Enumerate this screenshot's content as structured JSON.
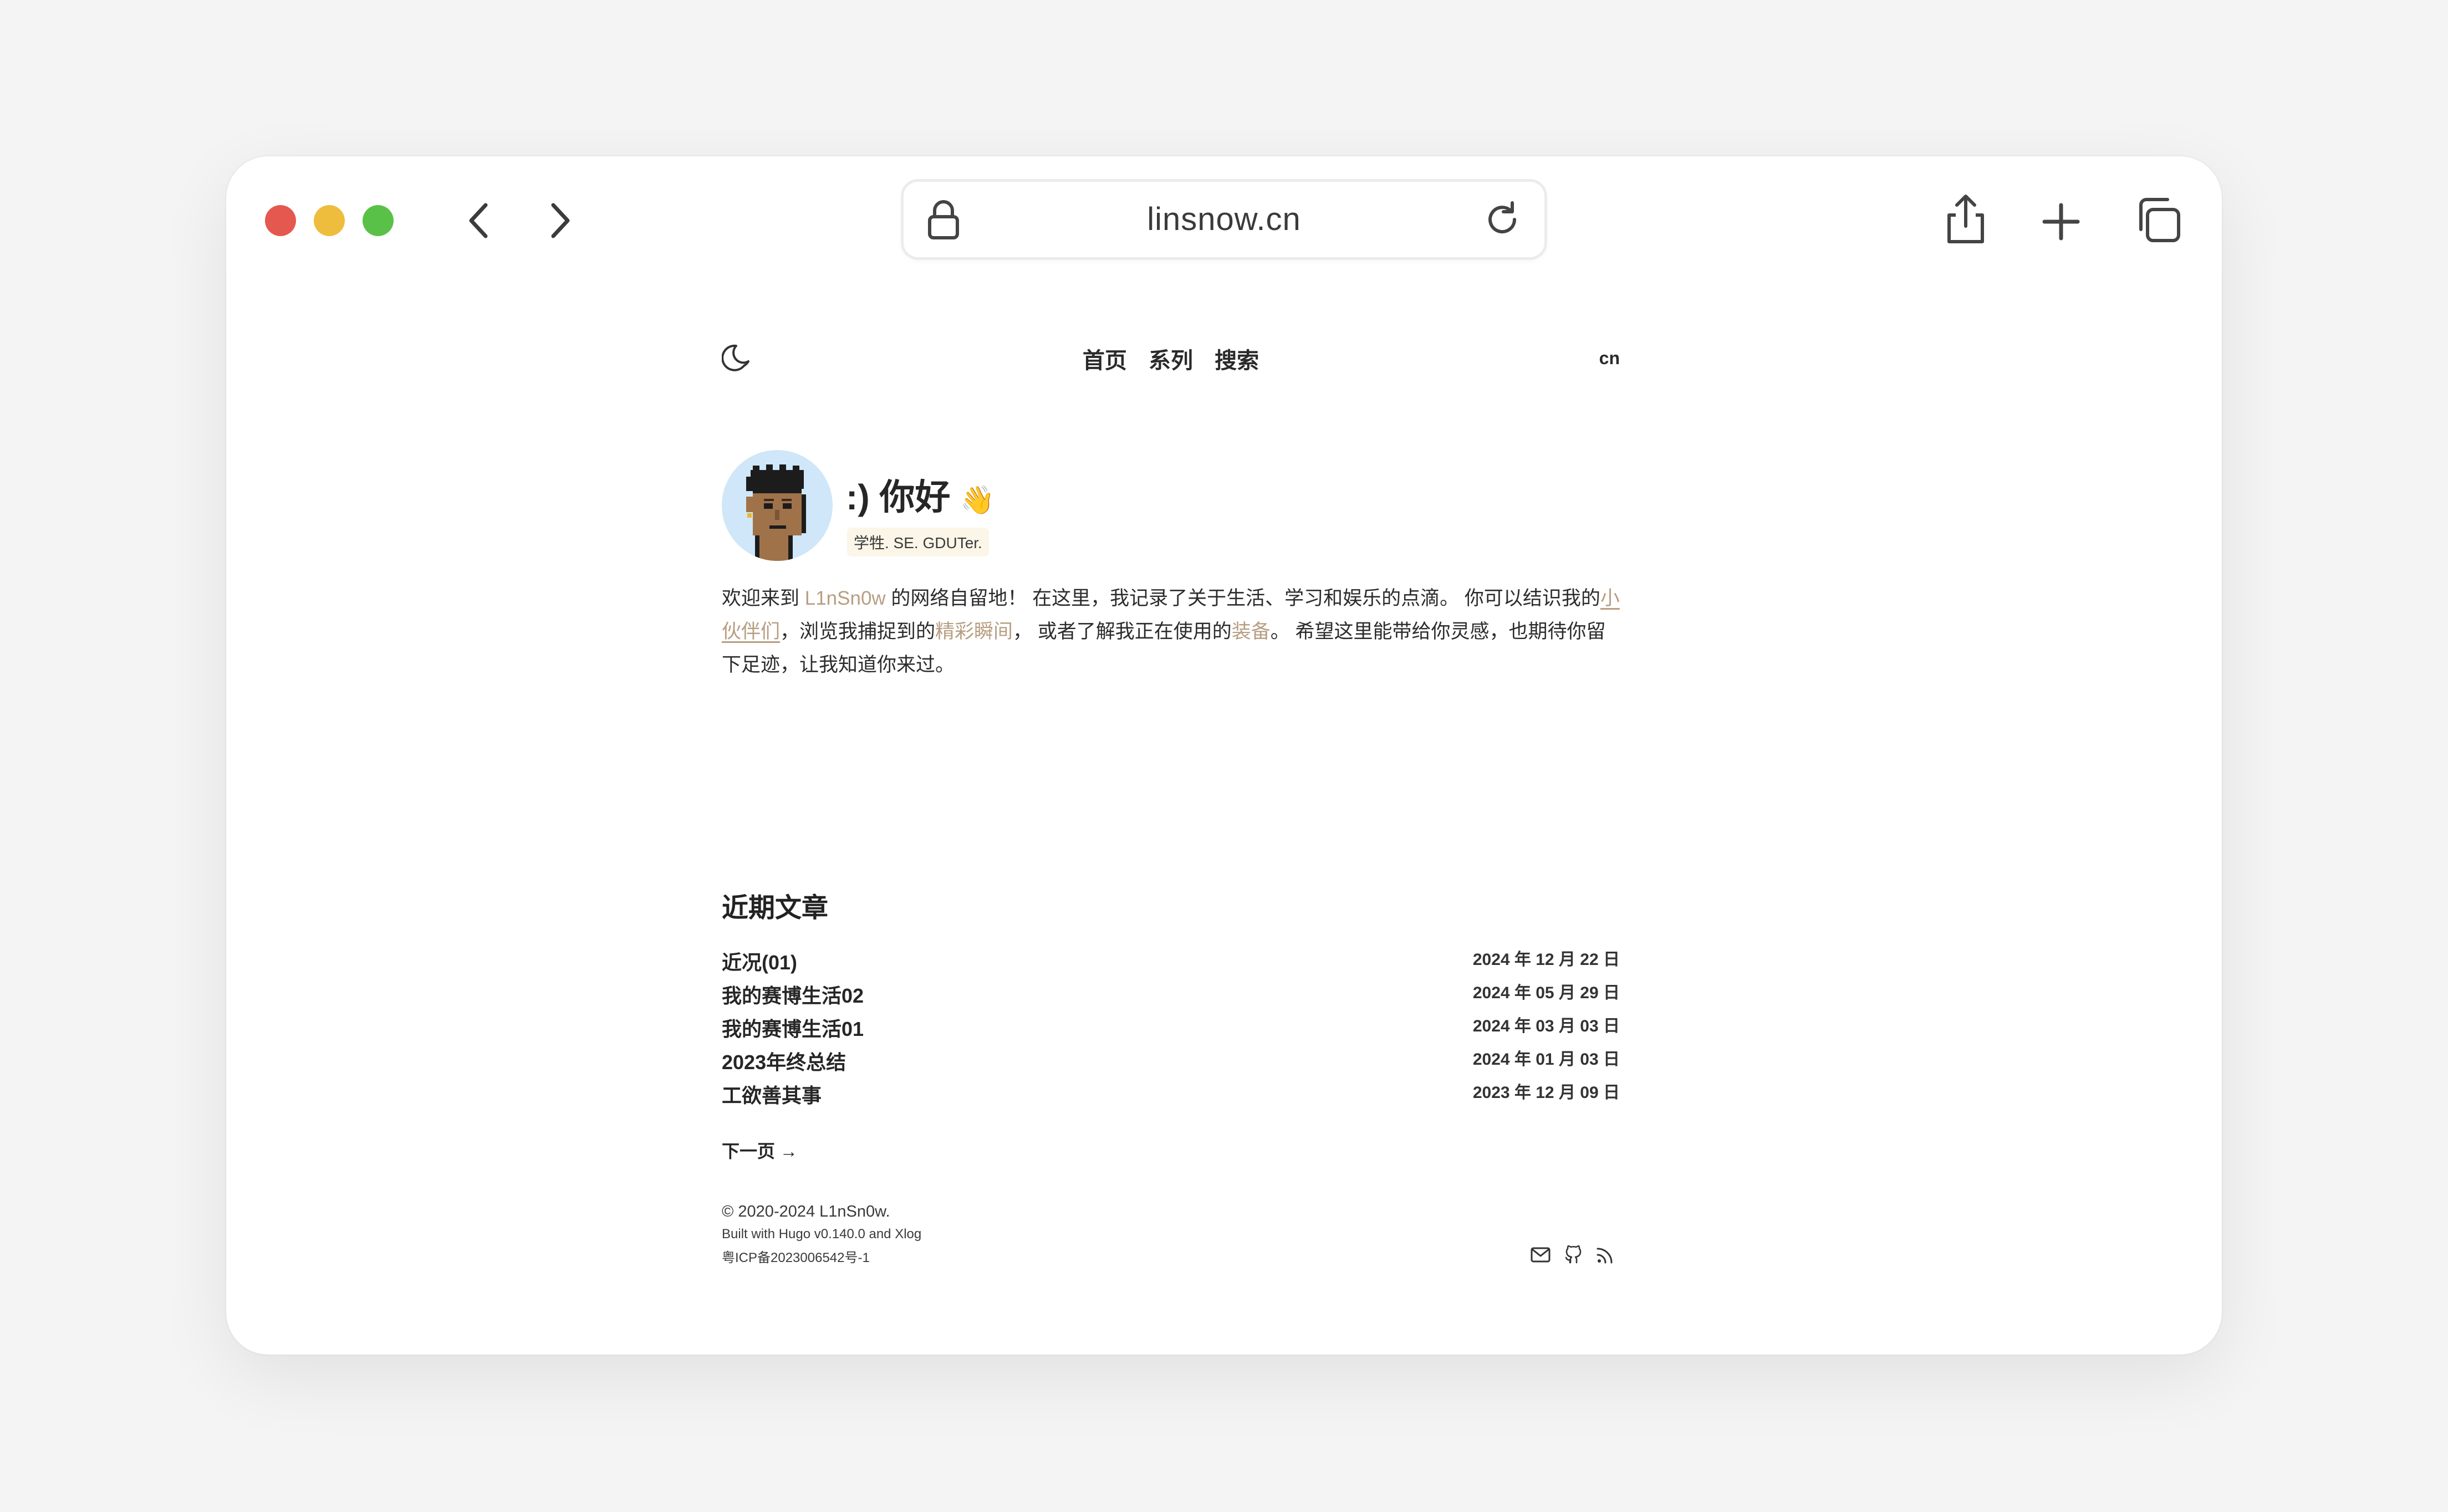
{
  "browser": {
    "url": "linsnow.cn",
    "icons": [
      "back-icon",
      "forward-icon",
      "lock-icon",
      "reload-icon",
      "share-icon",
      "plus-icon",
      "tabs-icon"
    ]
  },
  "nav": {
    "links": [
      "首页",
      "系列",
      "搜索"
    ],
    "lang": "cn",
    "theme_icon": "moon-icon"
  },
  "profile": {
    "greeting": ":) 你好",
    "wave": "👋",
    "tagline": "学牲. SE. GDUTer."
  },
  "intro": {
    "p1": "欢迎来到 ",
    "name_link": "L1nSn0w",
    "p2": " 的网络自留地！ 在这里，我记录了关于生活、学习和娱乐的点滴。 你可以结识我的",
    "friends_link": "小伙伴们",
    "p3": "，浏览我捕捉到的",
    "moments_link": "精彩瞬间",
    "p4": "， 或者了解我正在使用的",
    "gear_link": "装备",
    "p5": "。 希望这里能带给你灵感，也期待你留下足迹，让我知道你来过。"
  },
  "recent": {
    "title": "近期文章",
    "posts": [
      {
        "title": "近况(01)",
        "date": "2024 年 12 月 22 日"
      },
      {
        "title": "我的赛博生活02",
        "date": "2024 年 05 月 29 日"
      },
      {
        "title": "我的赛博生活01",
        "date": "2024 年 03 月 03 日"
      },
      {
        "title": "2023年终总结",
        "date": "2024 年 01 月 03 日"
      },
      {
        "title": "工欲善其事",
        "date": "2023 年 12 月 09 日"
      }
    ],
    "next": "下一页 →"
  },
  "footer": {
    "copyright": "© 2020-2024 L1nSn0w.",
    "built": "Built with Hugo v0.140.0 and Xlog",
    "icp": "粤ICP备2023006542号-1",
    "icons": [
      "mail-icon",
      "github-icon",
      "rss-icon"
    ]
  },
  "colors": {
    "link": "#b79e82",
    "avatar_bg": "#cfe7f8",
    "tagline_bg": "#fbf6e8"
  }
}
